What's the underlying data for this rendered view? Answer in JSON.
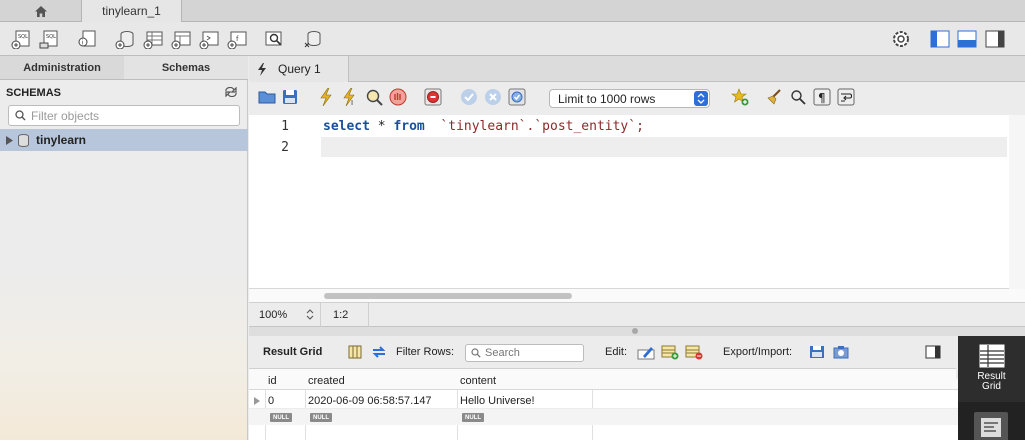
{
  "window": {
    "connection_tab": "tinylearn_1"
  },
  "left_panel": {
    "tabs": [
      "Administration",
      "Schemas"
    ],
    "active_tab": "Schemas",
    "section_title": "SCHEMAS",
    "filter_placeholder": "Filter objects",
    "schemas": [
      {
        "name": "tinylearn",
        "expanded": false,
        "selected": true
      }
    ]
  },
  "query_tab": {
    "label": "Query 1"
  },
  "query_toolbar": {
    "limit_select": "Limit to 1000 rows"
  },
  "editor": {
    "lines": [
      {
        "num": "1",
        "keyword1": "select",
        "op": " * ",
        "keyword2": "from",
        "rest": "  `tinylearn`.`post_entity`;"
      },
      {
        "num": "2",
        "keyword1": "",
        "op": "",
        "keyword2": "",
        "rest": ""
      }
    ],
    "keyword_color": "#1a4fa0",
    "identifier_color": "#8b2a2a"
  },
  "status": {
    "zoom": "100%",
    "cursor": "1:2"
  },
  "results": {
    "grid_label": "Result Grid",
    "filter_label": "Filter Rows:",
    "search_placeholder": "Search",
    "edit_label": "Edit:",
    "export_label": "Export/Import:",
    "columns": [
      "id",
      "created",
      "content"
    ],
    "rows": [
      {
        "id": "0",
        "created": "2020-06-09 06:58:57.147",
        "content": "Hello Universe!"
      },
      {
        "id": "NULL",
        "created": "NULL",
        "content": "NULL"
      }
    ]
  },
  "side_panel": {
    "result_grid_label_1": "Result",
    "result_grid_label_2": "Grid"
  }
}
